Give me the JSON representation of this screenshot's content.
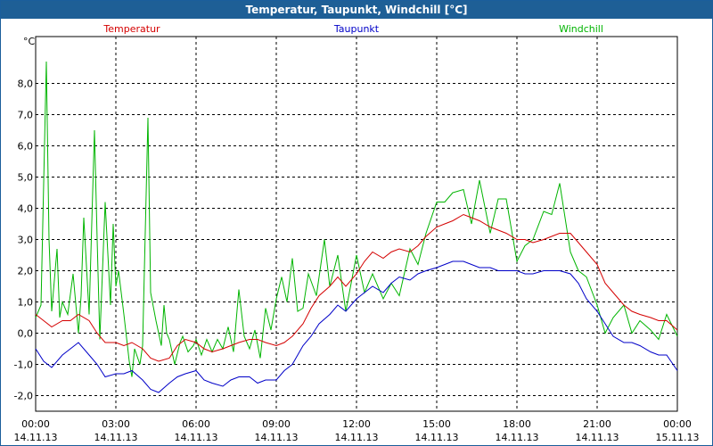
{
  "window": {
    "title": "Temperatur, Taupunkt, Windchill [°C]"
  },
  "chart_data": {
    "type": "line",
    "title": "Temperatur, Taupunkt, Windchill [°C]",
    "ylabel": "°C",
    "xlabel": "",
    "ylim": [
      -2.5,
      9.5
    ],
    "xlim": [
      0,
      24
    ],
    "grid": true,
    "legend_position": "top",
    "y_ticks": [
      -2,
      -1,
      0,
      1,
      2,
      3,
      4,
      5,
      6,
      7,
      8
    ],
    "y_tick_labels": [
      "-2,0",
      "-1,0",
      "0,0",
      "1,0",
      "2,0",
      "3,0",
      "4,0",
      "5,0",
      "6,0",
      "7,0",
      "8,0"
    ],
    "x_ticks": [
      0,
      3,
      6,
      9,
      12,
      15,
      18,
      21,
      24
    ],
    "x_tick_labels": [
      {
        "time": "00:00",
        "date": "14.11.13"
      },
      {
        "time": "03:00",
        "date": "14.11.13"
      },
      {
        "time": "06:00",
        "date": "14.11.13"
      },
      {
        "time": "09:00",
        "date": "14.11.13"
      },
      {
        "time": "12:00",
        "date": "14.11.13"
      },
      {
        "time": "15:00",
        "date": "14.11.13"
      },
      {
        "time": "18:00",
        "date": "14.11.13"
      },
      {
        "time": "21:00",
        "date": "14.11.13"
      },
      {
        "time": "00:00",
        "date": "15.11.13"
      }
    ],
    "series": [
      {
        "name": "Temperatur",
        "color": "#d40000",
        "x": [
          0,
          0.3,
          0.6,
          1,
          1.3,
          1.6,
          2,
          2.3,
          2.6,
          3,
          3.3,
          3.6,
          4,
          4.3,
          4.6,
          5,
          5.3,
          5.6,
          6,
          6.3,
          6.6,
          7,
          7.3,
          7.6,
          8,
          8.3,
          8.6,
          9,
          9.3,
          9.6,
          10,
          10.3,
          10.6,
          11,
          11.3,
          11.6,
          12,
          12.3,
          12.6,
          13,
          13.3,
          13.6,
          14,
          14.3,
          14.6,
          15,
          15.3,
          15.6,
          16,
          16.3,
          16.6,
          17,
          17.3,
          17.6,
          18,
          18.3,
          18.6,
          19,
          19.3,
          19.6,
          20,
          20.3,
          20.6,
          21,
          21.3,
          21.6,
          22,
          22.3,
          22.6,
          23,
          23.3,
          23.6,
          24
        ],
        "values": [
          0.6,
          0.4,
          0.2,
          0.4,
          0.4,
          0.6,
          0.4,
          0.0,
          -0.3,
          -0.3,
          -0.4,
          -0.3,
          -0.5,
          -0.8,
          -0.9,
          -0.8,
          -0.4,
          -0.2,
          -0.3,
          -0.5,
          -0.6,
          -0.5,
          -0.4,
          -0.3,
          -0.2,
          -0.2,
          -0.3,
          -0.4,
          -0.3,
          -0.1,
          0.3,
          0.8,
          1.2,
          1.5,
          1.8,
          1.5,
          1.9,
          2.3,
          2.6,
          2.4,
          2.6,
          2.7,
          2.6,
          2.8,
          3.1,
          3.4,
          3.5,
          3.6,
          3.8,
          3.7,
          3.6,
          3.4,
          3.3,
          3.2,
          3.0,
          3.0,
          2.9,
          3.0,
          3.1,
          3.2,
          3.2,
          2.9,
          2.6,
          2.2,
          1.6,
          1.3,
          0.9,
          0.7,
          0.6,
          0.5,
          0.4,
          0.4,
          0.1
        ]
      },
      {
        "name": "Taupunkt",
        "color": "#0000c8",
        "x": [
          0,
          0.3,
          0.6,
          1,
          1.3,
          1.6,
          2,
          2.3,
          2.6,
          3,
          3.3,
          3.6,
          4,
          4.3,
          4.6,
          5,
          5.3,
          5.6,
          6,
          6.3,
          6.6,
          7,
          7.3,
          7.6,
          8,
          8.3,
          8.6,
          9,
          9.3,
          9.6,
          10,
          10.3,
          10.6,
          11,
          11.3,
          11.6,
          12,
          12.3,
          12.6,
          13,
          13.3,
          13.6,
          14,
          14.3,
          14.6,
          15,
          15.3,
          15.6,
          16,
          16.3,
          16.6,
          17,
          17.3,
          17.6,
          18,
          18.3,
          18.6,
          19,
          19.3,
          19.6,
          20,
          20.3,
          20.6,
          21,
          21.3,
          21.6,
          22,
          22.3,
          22.6,
          23,
          23.3,
          23.6,
          24
        ],
        "values": [
          -0.5,
          -0.9,
          -1.1,
          -0.7,
          -0.5,
          -0.3,
          -0.7,
          -1.0,
          -1.4,
          -1.3,
          -1.3,
          -1.2,
          -1.5,
          -1.8,
          -1.9,
          -1.6,
          -1.4,
          -1.3,
          -1.2,
          -1.5,
          -1.6,
          -1.7,
          -1.5,
          -1.4,
          -1.4,
          -1.6,
          -1.5,
          -1.5,
          -1.2,
          -1.0,
          -0.4,
          -0.1,
          0.3,
          0.6,
          0.9,
          0.7,
          1.1,
          1.3,
          1.5,
          1.3,
          1.6,
          1.8,
          1.7,
          1.9,
          2.0,
          2.1,
          2.2,
          2.3,
          2.3,
          2.2,
          2.1,
          2.1,
          2.0,
          2.0,
          2.0,
          1.9,
          1.9,
          2.0,
          2.0,
          2.0,
          1.9,
          1.6,
          1.1,
          0.7,
          0.3,
          -0.1,
          -0.3,
          -0.3,
          -0.4,
          -0.6,
          -0.7,
          -0.7,
          -1.2
        ]
      },
      {
        "name": "Windchill",
        "color": "#00b400",
        "x": [
          0,
          0.2,
          0.4,
          0.5,
          0.6,
          0.8,
          0.9,
          1.0,
          1.2,
          1.4,
          1.6,
          1.7,
          1.8,
          2.0,
          2.2,
          2.3,
          2.4,
          2.6,
          2.8,
          2.9,
          3.0,
          3.1,
          3.3,
          3.5,
          3.6,
          3.7,
          3.9,
          4.0,
          4.2,
          4.3,
          4.5,
          4.7,
          4.8,
          4.9,
          5.0,
          5.2,
          5.4,
          5.5,
          5.7,
          5.9,
          6.0,
          6.2,
          6.4,
          6.6,
          6.8,
          7.0,
          7.2,
          7.4,
          7.6,
          7.8,
          8.0,
          8.2,
          8.4,
          8.6,
          8.8,
          9.0,
          9.2,
          9.4,
          9.6,
          9.8,
          10.0,
          10.2,
          10.5,
          10.8,
          11.0,
          11.3,
          11.6,
          12.0,
          12.3,
          12.6,
          13.0,
          13.3,
          13.6,
          14.0,
          14.3,
          14.6,
          15.0,
          15.3,
          15.6,
          16.0,
          16.3,
          16.6,
          17.0,
          17.3,
          17.6,
          18.0,
          18.3,
          18.6,
          19.0,
          19.3,
          19.6,
          20.0,
          20.3,
          20.6,
          21.0,
          21.3,
          21.6,
          22.0,
          22.3,
          22.6,
          23.0,
          23.3,
          23.6,
          24.0
        ],
        "values": [
          0.5,
          0.9,
          8.7,
          3.0,
          0.7,
          2.7,
          0.5,
          1.0,
          0.6,
          1.9,
          0.0,
          1.2,
          3.7,
          0.6,
          6.5,
          3.0,
          -0.2,
          4.2,
          0.9,
          3.5,
          1.5,
          2.0,
          0.6,
          -0.9,
          -1.4,
          -0.5,
          -1.0,
          -0.4,
          6.9,
          1.3,
          0.4,
          -0.4,
          0.9,
          0.0,
          -0.2,
          -1.0,
          -0.3,
          -0.1,
          -0.6,
          -0.4,
          -0.2,
          -0.7,
          -0.2,
          -0.6,
          -0.2,
          -0.5,
          0.2,
          -0.6,
          1.4,
          -0.1,
          -0.5,
          0.1,
          -0.8,
          0.8,
          0.1,
          1.1,
          1.8,
          1.0,
          2.4,
          0.7,
          0.8,
          1.9,
          1.2,
          3.0,
          1.5,
          2.5,
          0.7,
          2.5,
          1.3,
          1.9,
          1.1,
          1.6,
          1.2,
          2.7,
          2.2,
          3.2,
          4.2,
          4.2,
          4.5,
          4.6,
          3.5,
          4.9,
          3.2,
          4.3,
          4.3,
          2.3,
          2.8,
          3.0,
          3.9,
          3.8,
          4.8,
          2.6,
          2.0,
          1.8,
          0.9,
          0.0,
          0.5,
          0.9,
          0.0,
          0.4,
          0.1,
          -0.2,
          0.6,
          -0.1
        ]
      }
    ]
  }
}
